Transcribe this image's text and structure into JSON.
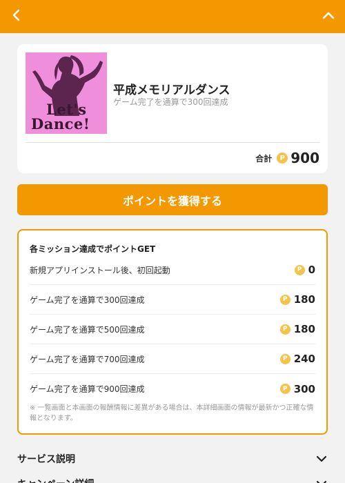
{
  "colors": {
    "accent": "#f39800",
    "coin": "#f5c24a",
    "background": "#f2f2f2"
  },
  "header": {
    "back_icon": "chevron-left-icon",
    "collapse_icon": "chevron-up-icon"
  },
  "offer": {
    "image_text_line1": "Let's",
    "image_text_line2": "Dance!",
    "title": "平成メモリアルダンス",
    "subtitle": "ゲーム完了を通算で300回達成",
    "total_label": "合計",
    "coin_symbol": "P",
    "total_points": "900"
  },
  "cta": {
    "label": "ポイントを獲得する"
  },
  "missions": {
    "heading": "各ミッション達成でポイントGET",
    "items": [
      {
        "label": "新規アプリインストール後、初回起動",
        "points": "0"
      },
      {
        "label": "ゲーム完了を通算で300回達成",
        "points": "180"
      },
      {
        "label": "ゲーム完了を通算で500回達成",
        "points": "180"
      },
      {
        "label": "ゲーム完了を通算で700回達成",
        "points": "240"
      },
      {
        "label": "ゲーム完了を通算で900回達成",
        "points": "300"
      }
    ],
    "note": "※ 一覧画面と本画面の報酬情報に差異がある場合は、本詳細画面の情報が最新かつ正確な情報となります。"
  },
  "accordions": [
    {
      "label": "サービス説明"
    },
    {
      "label": "キャンペーン詳細"
    }
  ]
}
